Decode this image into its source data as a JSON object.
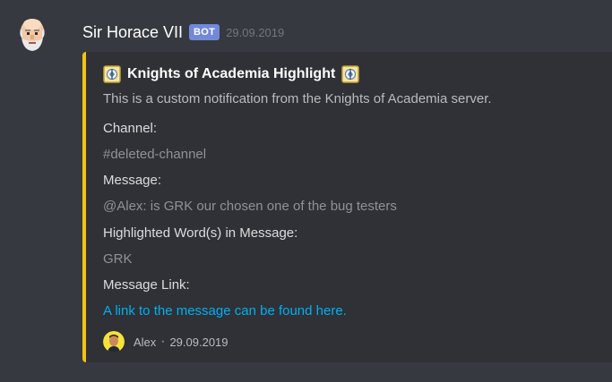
{
  "message": {
    "author": "Sir Horace VII",
    "bot_tag": "BOT",
    "timestamp": "29.09.2019"
  },
  "embed": {
    "accent_color": "#f1c40f",
    "title": "Knights of Academia Highlight",
    "description": "This is a custom notification from the Knights of Academia server.",
    "fields": [
      {
        "name": "Channel:",
        "value": "#deleted-channel"
      },
      {
        "name": "Message:",
        "value": "@Alex: is GRK our chosen one of the bug testers"
      },
      {
        "name": "Highlighted Word(s) in Message:",
        "value": "GRK"
      },
      {
        "name": "Message Link:",
        "value": "A link to the message can be found here."
      }
    ],
    "footer": {
      "author": "Alex",
      "separator": "•",
      "timestamp": "29.09.2019"
    }
  },
  "icons": {
    "avatar": "bearded-old-man-avatar",
    "emblem": "academia-emblem-icon",
    "footer_avatar": "alex-avatar"
  }
}
